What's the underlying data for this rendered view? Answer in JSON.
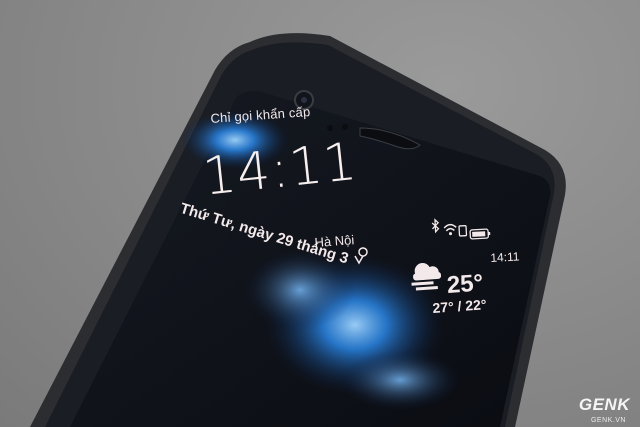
{
  "lockscreen": {
    "emergency_label": "Chỉ gọi khẩn cấp",
    "clock": "14:11",
    "city": "Hà Nội",
    "date": "Thứ Tư, ngày 29 tháng 3"
  },
  "status_bar": {
    "time": "14:11",
    "icons": [
      "bluetooth-icon",
      "wifi-icon",
      "sim-icon",
      "battery-icon"
    ]
  },
  "weather": {
    "icon": "cloud-rain-icon",
    "temperature": "25°",
    "range": "27° / 22°"
  },
  "watermark": {
    "brand": "GENK",
    "site": "GENK.VN"
  }
}
